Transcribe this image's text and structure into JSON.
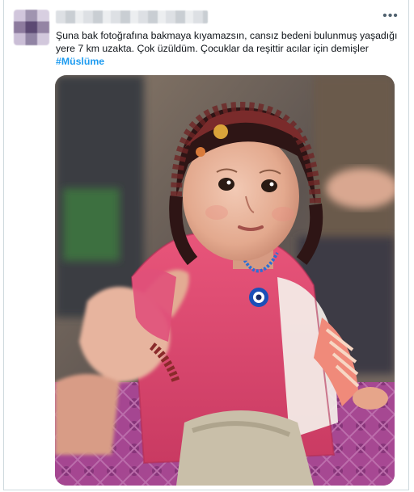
{
  "tweet": {
    "text_lines": [
      "Şuna bak fotoğrafına bakmaya kıyamazsın, cansız bedeni bulunmuş yaşadığı",
      "yere 7 km uzakta. Çok üzüldüm. Çocuklar da reşittir acılar için demişler"
    ],
    "hashtag": "#Müslüme",
    "more_label": "•••"
  },
  "colors": {
    "accent": "#1d9bf0",
    "text": "#0f1419",
    "border": "#cfd9de"
  },
  "icons": {
    "more": "more-horizontal-icon"
  }
}
